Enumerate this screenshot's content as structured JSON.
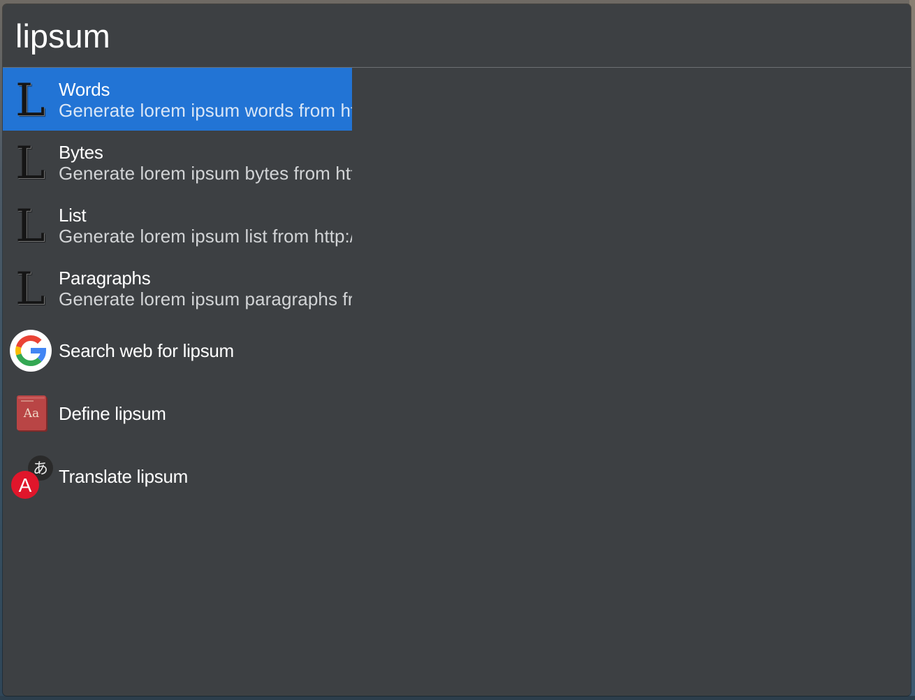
{
  "search": {
    "query": "lipsum"
  },
  "results": [
    {
      "title": "Words",
      "subtitle": "Generate lorem ipsum words from http://www.lipsum.com",
      "icon": "lipsum-l-icon",
      "selected": true
    },
    {
      "title": "Bytes",
      "subtitle": "Generate lorem ipsum bytes from http://www.lipsum.com",
      "icon": "lipsum-l-icon",
      "selected": false
    },
    {
      "title": "List",
      "subtitle": "Generate lorem ipsum list from http://www.lipsum.com",
      "icon": "lipsum-l-icon",
      "selected": false
    },
    {
      "title": "Paragraphs",
      "subtitle": "Generate lorem ipsum paragraphs from http://www.lipsum.com",
      "icon": "lipsum-l-icon",
      "selected": false
    },
    {
      "title": "Search web for lipsum",
      "icon": "google-icon",
      "selected": false
    },
    {
      "title": "Define lipsum",
      "icon": "dictionary-icon",
      "icon_text": "Aa",
      "selected": false
    },
    {
      "title": "Translate lipsum",
      "icon": "translate-icon",
      "icon_text_a": "A",
      "icon_text_b": "あ",
      "selected": false
    }
  ],
  "colors": {
    "window_bg": "#3d4043",
    "selected_bg": "#2274d5",
    "title_text": "#ffffff",
    "subtitle_text": "#d2d4d6"
  }
}
